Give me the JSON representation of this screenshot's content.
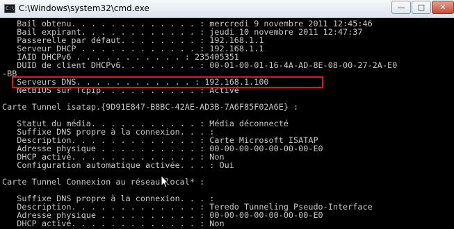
{
  "window": {
    "title": "C:\\Windows\\system32\\cmd.exe",
    "icon": "cmd-console-icon",
    "icon_glyph": "C:\\",
    "minimize_label": "—",
    "maximize_label": "□",
    "close_label": "✕"
  },
  "console": {
    "lines": [
      "   Bail obtenu. . . . . . . . . . . . . : mercredi 9 novembre 2011 12:45:46",
      "   Bail expirant. . . . . . . . . . . . : jeudi 10 novembre 2011 12:47:37",
      "   Passerelle par défaut. . . . . . . . : 192.168.1.1",
      "   Serveur DHCP . . . . . . . . . . . . : 192.168.1.1",
      "   IAID DHCPv6 . . . . . . . . . . . : 235405351",
      "   DUID de client DHCPv6. . . . . . . . : 00-01-00-01-16-4A-AD-8E-08-00-27-2A-E0",
      "-BB",
      "   Serveurs DNS. . . . . . . . . . . . : 192.168.1.100",
      "   NetBIOS sur Tcpip. . . . . . . . . . : Activé",
      "",
      "Carte Tunnel isatap.{9D91E847-B8BC-42AE-AD3B-7A6F85F02A6E} :",
      "",
      "   Statut du média. . . . . . . . . . . : Média déconnecté",
      "   Suffixe DNS propre à la connexion. . . :",
      "   Description. . . . . . . . . . . . . : Carte Microsoft ISATAP",
      "   Adresse physique . . . . . . . . . . : 00-00-00-00-00-00-00-E0",
      "   DHCP activé. . . . . . . . . . . . . : Non",
      "   Configuration automatique activée. . . : Oui",
      "",
      "Carte Tunnel Connexion au réseau local* :",
      "",
      "   Suffixe DNS propre à la connexion. . . :",
      "   Description. . . . . . . . . . . . . : Teredo Tunneling Pseudo-Interface",
      "   Adresse physique . . . . . . . . . . : 00-00-00-00-00-00-00-E0",
      "   DHCP activé. . . . . . . . . . . . . : Non"
    ]
  },
  "annotation": {
    "highlight_color": "#e0142a",
    "highlighted_line": "   Serveurs DNS. . . . . . . . . . . . : 192.168.1.100"
  },
  "colors": {
    "console_background": "#000000",
    "console_text": "#c8c8c8"
  },
  "cursor": {
    "icon": "mouse-pointer-icon"
  }
}
